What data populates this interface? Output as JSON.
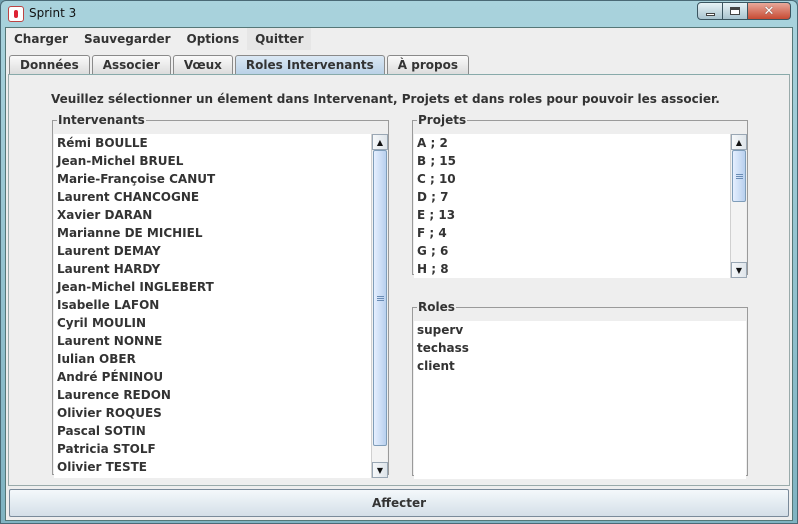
{
  "window": {
    "title": "Sprint 3"
  },
  "menubar": [
    "Charger",
    "Sauvegarder",
    "Options",
    "Quitter"
  ],
  "tabs": [
    "Données",
    "Associer",
    "Vœux",
    "Roles Intervenants",
    "À propos"
  ],
  "active_tab": "Roles Intervenants",
  "instructions": "Veuillez sélectionner un élement dans Intervenant, Projets et dans roles pour pouvoir les associer.",
  "intervenants": {
    "legend": "Intervenants",
    "items": [
      "Rémi BOULLE",
      "Jean-Michel BRUEL",
      "Marie-Françoise CANUT",
      "Laurent CHANCOGNE",
      "Xavier DARAN",
      "Marianne DE MICHIEL",
      "Laurent DEMAY",
      "Laurent HARDY",
      "Jean-Michel INGLEBERT",
      "Isabelle LAFON",
      "Cyril MOULIN",
      "Laurent NONNE",
      "Iulian OBER",
      "André PÉNINOU",
      "Laurence REDON",
      "Olivier ROQUES",
      "Pascal SOTIN",
      "Patricia STOLF",
      "Olivier TESTE"
    ]
  },
  "projets": {
    "legend": "Projets",
    "items": [
      "A ; 2",
      "B ; 15",
      "C ; 10",
      "D ; 7",
      "E ; 13",
      "F ; 4",
      "G ; 6",
      "H ; 8"
    ]
  },
  "roles": {
    "legend": "Roles",
    "items": [
      "superv",
      "techass",
      "client"
    ]
  },
  "affecter_label": "Affecter"
}
